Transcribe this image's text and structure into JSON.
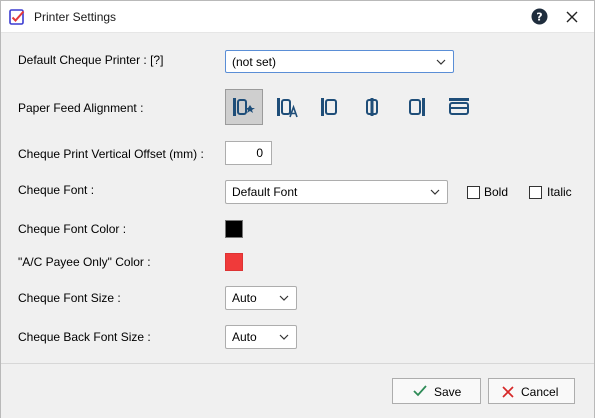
{
  "window": {
    "title": "Printer Settings",
    "help_label": "?",
    "close_label": "Close"
  },
  "form": {
    "default_printer_label": "Default Cheque Printer : [?]",
    "default_printer_value": "(not set)",
    "paper_feed_label": "Paper Feed Alignment :",
    "paper_feed_options": [
      "center-in-alignment",
      "left-alignment",
      "left-edge",
      "center",
      "right-edge",
      "top-horizontal"
    ],
    "paper_feed_selected_index": 0,
    "vertical_offset_label": "Cheque Print Vertical Offset (mm) :",
    "vertical_offset_value": "0",
    "font_label": "Cheque Font :",
    "font_value": "Default Font",
    "bold_label": "Bold",
    "bold_checked": false,
    "italic_label": "Italic",
    "italic_checked": false,
    "font_color_label": "Cheque Font Color :",
    "font_color": "#000000",
    "payee_color_label": "\"A/C Payee Only\" Color :",
    "payee_color": "#f03a3a",
    "font_size_label": "Cheque Font Size :",
    "font_size_value": "Auto",
    "back_font_size_label": "Cheque Back Font Size :",
    "back_font_size_value": "Auto"
  },
  "footer": {
    "save_label": "Save",
    "cancel_label": "Cancel",
    "save_icon": "check-icon",
    "cancel_icon": "x-icon"
  }
}
